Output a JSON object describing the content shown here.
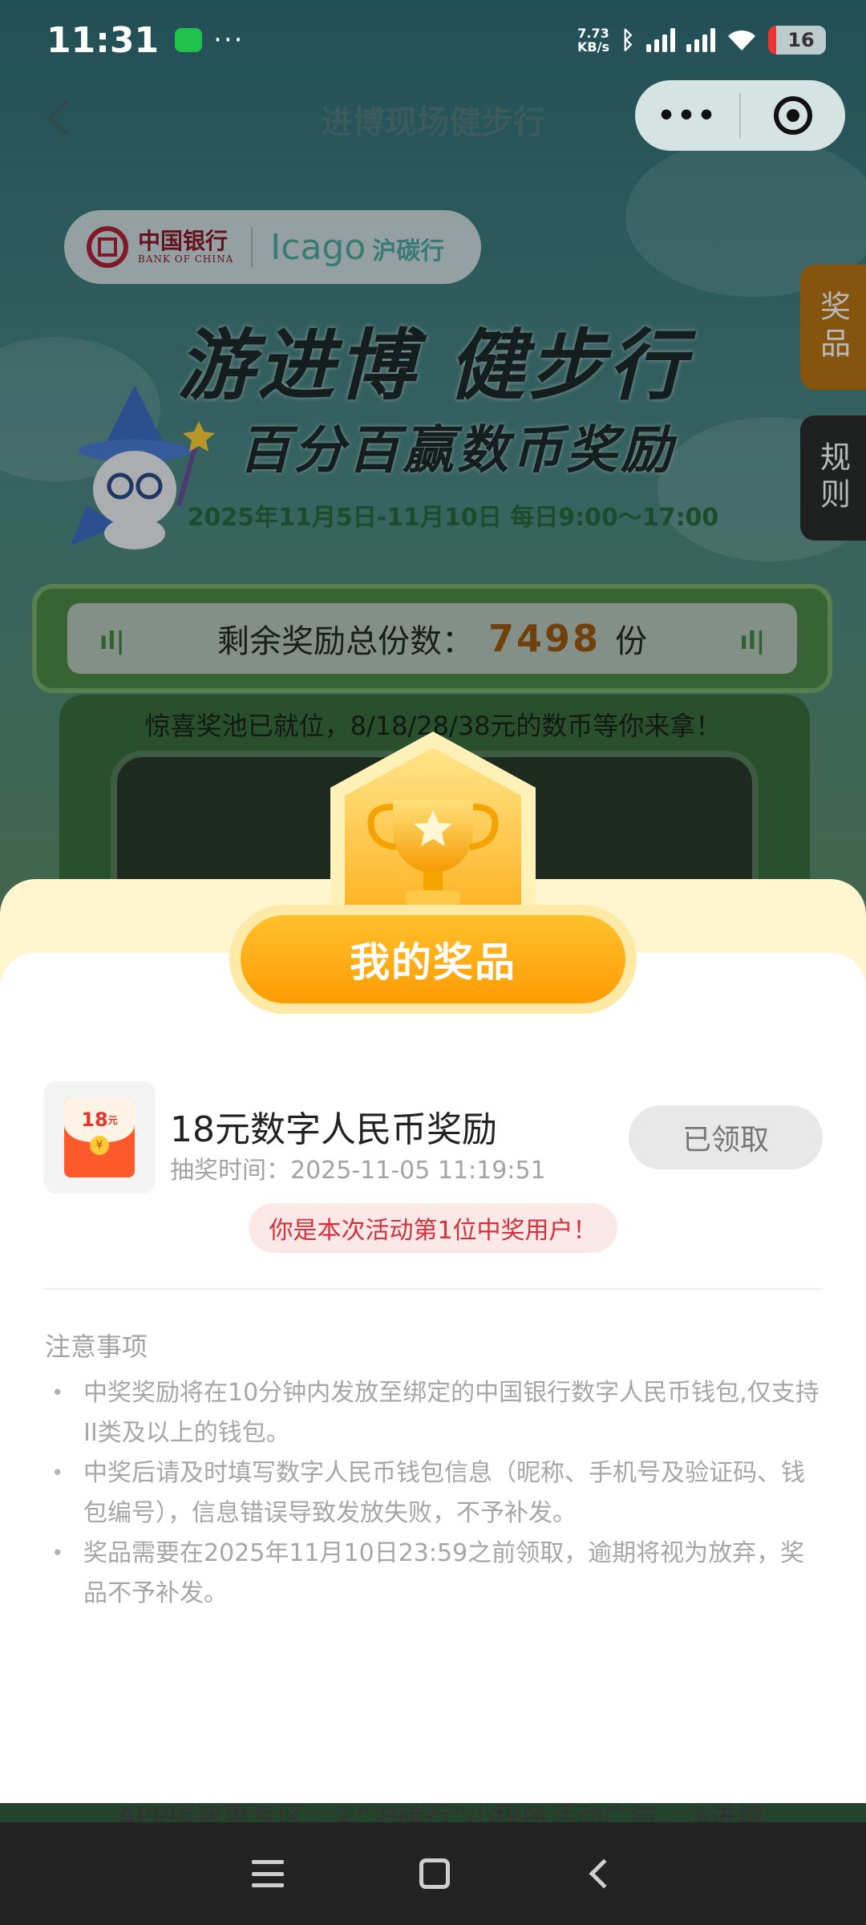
{
  "status_bar": {
    "time": "11:31",
    "dots": "···",
    "speed_value": "7.73",
    "speed_unit": "KB/s",
    "battery": "16"
  },
  "nav": {
    "title": "进博现场健步行",
    "more_label": "•••"
  },
  "banner": {
    "boc_cn": "中国银行",
    "boc_en": "BANK OF CHINA",
    "icago_brand": "Icago",
    "icago_cn": "沪碳行",
    "headline": "游进博 健步行",
    "subheadline": "百分百赢数币奖励",
    "date_range": "2025年11月5日-11月10日 每日9:00～17:00"
  },
  "side_tabs": {
    "prizes": "奖品",
    "rules": "规则"
  },
  "counter": {
    "label": "剩余奖励总份数：",
    "value": "7498",
    "unit": "份",
    "mark": "ıl|"
  },
  "pool_text": "惊喜奖池已就位，8/18/28/38元的数币等你来拿！",
  "sheet": {
    "title": "我的奖品",
    "prize": {
      "thumb_amount": "18",
      "thumb_unit": "元",
      "thumb_coin": "¥",
      "name": "18元数字人民币奖励",
      "time": "抽奖时间：2025-11-05 11:19:51",
      "status": "已领取"
    },
    "winner_note": "你是本次活动第1位中奖用户！",
    "notes_title": "注意事项",
    "notes": [
      "中奖奖励将在10分钟内发放至绑定的中国银行数字人民币钱包,仅支持II类及以上的钱包。",
      "中奖后请及时填写数字人民币钱包信息（昵称、手机号及验证码、钱包编号），信息错误导致发放失败，不予补发。",
      "奖品需要在2025年11月10日23:59之前领取，逾期将视为放弃，奖品不予补发。"
    ]
  },
  "peek_text": "APP碳普惠专区，②“沪碳行”小程序活动广告，③进博",
  "colors": {
    "accent_orange": "#ff9b05",
    "warning_red": "#d2323b",
    "counter_orange": "#9c5a12"
  }
}
